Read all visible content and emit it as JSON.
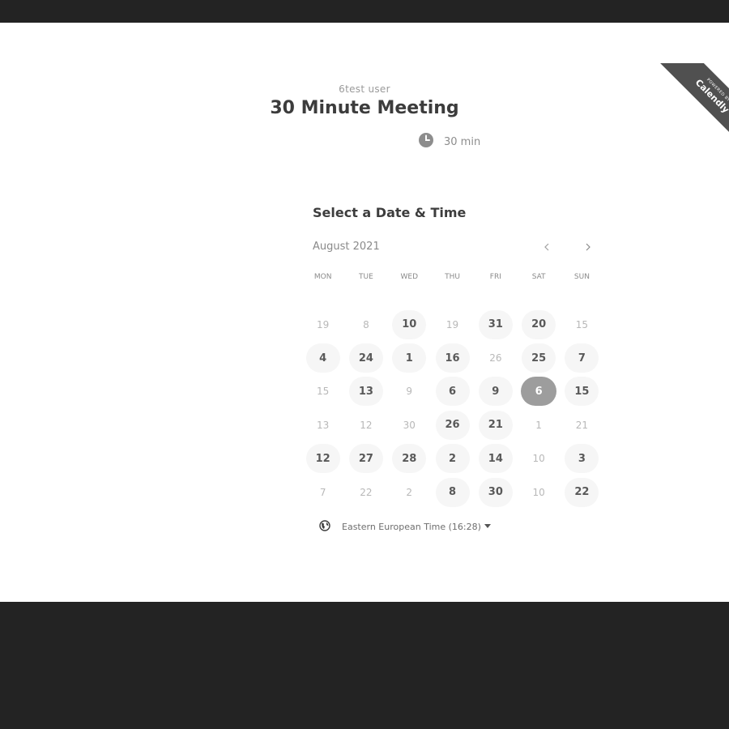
{
  "colors": {
    "frame_background": "#232323",
    "panel_background": "#ffffff",
    "ribbon_background": "#505050",
    "available_day_background": "#f6f6f6",
    "selected_day_background": "#9d9d9d"
  },
  "ribbon": {
    "powered_label": "Powered by",
    "brand": "Calendly"
  },
  "event": {
    "owner": "6test user",
    "title": "30 Minute Meeting",
    "duration_icon": "clock-icon",
    "duration": "30 min"
  },
  "picker": {
    "heading": "Select a Date & Time",
    "month": "August 2021",
    "prev_icon": "chevron-left-icon",
    "next_icon": "chevron-right-icon",
    "weekdays": [
      "MON",
      "TUE",
      "WED",
      "THU",
      "FRI",
      "SAT",
      "SUN"
    ],
    "weeks": [
      [
        {
          "d": "19",
          "s": "off"
        },
        {
          "d": "8",
          "s": "off"
        },
        {
          "d": "10",
          "s": "available"
        },
        {
          "d": "19",
          "s": "off"
        },
        {
          "d": "31",
          "s": "available"
        },
        {
          "d": "20",
          "s": "available"
        },
        {
          "d": "15",
          "s": "off"
        }
      ],
      [
        {
          "d": "4",
          "s": "available"
        },
        {
          "d": "24",
          "s": "available"
        },
        {
          "d": "1",
          "s": "available"
        },
        {
          "d": "16",
          "s": "available"
        },
        {
          "d": "26",
          "s": "off"
        },
        {
          "d": "25",
          "s": "available"
        },
        {
          "d": "7",
          "s": "available"
        }
      ],
      [
        {
          "d": "15",
          "s": "off"
        },
        {
          "d": "13",
          "s": "available"
        },
        {
          "d": "9",
          "s": "off"
        },
        {
          "d": "6",
          "s": "available"
        },
        {
          "d": "9",
          "s": "available"
        },
        {
          "d": "6",
          "s": "selected"
        },
        {
          "d": "15",
          "s": "available"
        }
      ],
      [
        {
          "d": "13",
          "s": "off"
        },
        {
          "d": "12",
          "s": "off"
        },
        {
          "d": "30",
          "s": "off"
        },
        {
          "d": "26",
          "s": "available"
        },
        {
          "d": "21",
          "s": "available"
        },
        {
          "d": "1",
          "s": "off"
        },
        {
          "d": "21",
          "s": "off"
        }
      ],
      [
        {
          "d": "12",
          "s": "available"
        },
        {
          "d": "27",
          "s": "available"
        },
        {
          "d": "28",
          "s": "available"
        },
        {
          "d": "2",
          "s": "available"
        },
        {
          "d": "14",
          "s": "available"
        },
        {
          "d": "10",
          "s": "off"
        },
        {
          "d": "3",
          "s": "available"
        }
      ],
      [
        {
          "d": "7",
          "s": "off"
        },
        {
          "d": "22",
          "s": "off"
        },
        {
          "d": "2",
          "s": "off"
        },
        {
          "d": "8",
          "s": "available"
        },
        {
          "d": "30",
          "s": "available"
        },
        {
          "d": "10",
          "s": "off"
        },
        {
          "d": "22",
          "s": "available"
        }
      ]
    ]
  },
  "timezone": {
    "icon": "globe-icon",
    "label": "Eastern European Time (16:28)",
    "caret_icon": "caret-down-icon"
  }
}
